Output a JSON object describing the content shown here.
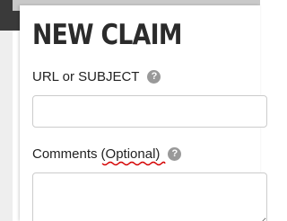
{
  "form": {
    "title": "NEW CLAIM",
    "url_field": {
      "label": "URL or SUBJECT",
      "help_glyph": "?",
      "value": "",
      "placeholder": ""
    },
    "comments_field": {
      "label": "Comments",
      "label_suffix": "(Optional)",
      "help_glyph": "?",
      "value": "",
      "placeholder": ""
    }
  },
  "icons": {
    "help": "question-circle-icon"
  },
  "colors": {
    "title": "#2b2b2b",
    "help_icon": "#999999",
    "spellcheck_underline": "#d40000",
    "field_border": "#cccccc"
  }
}
